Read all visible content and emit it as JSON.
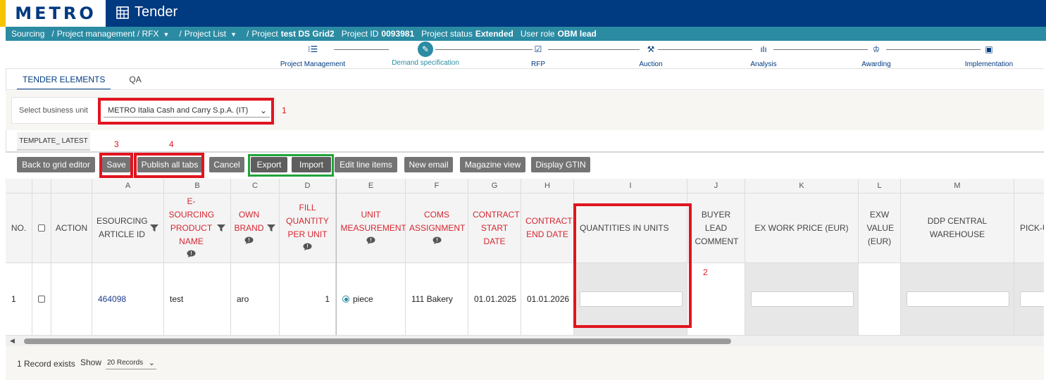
{
  "header": {
    "logo": "METRO",
    "app_title": "Tender",
    "icons": {
      "grid": "grid-table-icon"
    },
    "colors": {
      "header_bg": "#003a80",
      "accent": "#f5c300",
      "teal": "#2b8ba3"
    }
  },
  "breadcrumb": {
    "sourcing": "Sourcing",
    "sep": "/",
    "project_mgmt": "Project management / RFX",
    "project_list": "Project List",
    "project_label": "Project",
    "project_value": "test DS Grid2",
    "project_id_label": "Project ID",
    "project_id_value": "0093981",
    "status_label": "Project status",
    "status_value": "Extended",
    "role_label": "User role",
    "role_value": "OBM lead"
  },
  "stepper": {
    "steps": [
      {
        "label": "Project Management",
        "icon": "list-icon",
        "glyph": "⁝☰"
      },
      {
        "label": "Demand specification",
        "icon": "pencil-icon",
        "glyph": "✎",
        "active": true
      },
      {
        "label": "RFP",
        "icon": "clipboard-icon",
        "glyph": "☑"
      },
      {
        "label": "Auction",
        "icon": "gavel-icon",
        "glyph": "⚒"
      },
      {
        "label": "Analysis",
        "icon": "bar-chart-icon",
        "glyph": "ılı"
      },
      {
        "label": "Awarding",
        "icon": "award-icon",
        "glyph": "♔"
      },
      {
        "label": "Implementation",
        "icon": "chart-board-icon",
        "glyph": "▣"
      }
    ]
  },
  "tabs": {
    "tender_elements": "TENDER ELEMENTS",
    "qa": "QA"
  },
  "business_unit": {
    "label": "Select business unit",
    "value": "METRO Italia Cash and Carry S.p.A. (IT)"
  },
  "subtab": "TEMPLATE_ LATEST",
  "toolbar": {
    "back": "Back to grid editor",
    "save": "Save",
    "publish": "Publish all tabs",
    "cancel": "Cancel",
    "export": "Export",
    "import": "Import",
    "edit_lines": "Edit line items",
    "new_email": "New email",
    "magazine": "Magazine view",
    "gtin": "Display GTIN"
  },
  "annotations": {
    "a1": "1",
    "a2": "2",
    "a3": "3",
    "a4": "4"
  },
  "grid": {
    "letters": {
      "A": "A",
      "B": "B",
      "C": "C",
      "D": "D",
      "E": "E",
      "F": "F",
      "G": "G",
      "H": "H",
      "I": "I",
      "J": "J",
      "K": "K",
      "L": "L",
      "M": "M"
    },
    "headers": {
      "no": "NO.",
      "action": "ACTION",
      "a": "ESOURCING ARTICLE ID",
      "b": "E-SOURCING PRODUCT NAME",
      "c": "OWN BRAND",
      "d": "FILL QUANTITY PER UNIT",
      "e": "UNIT MEASUREMENT",
      "f": "COMS ASSIGNMENT",
      "g": "CONTRACT START DATE",
      "h": "CONTRACT END DATE",
      "i": "QUANTITIES IN UNITS",
      "j": "BUYER LEAD COMMENT",
      "k": "EX WORK PRICE (EUR)",
      "l": "EXW VALUE (EUR)",
      "m": "DDP CENTRAL WAREHOUSE",
      "n": "PICK-U"
    },
    "row": {
      "no": "1",
      "a": "464098",
      "b": "test",
      "c": "aro",
      "d": "1",
      "e": "piece",
      "f": "111 Bakery",
      "g": "01.01.2025",
      "h": "01.01.2026"
    }
  },
  "footer": {
    "records": "1 Record exists",
    "show": "Show",
    "page_size": "20 Records"
  }
}
